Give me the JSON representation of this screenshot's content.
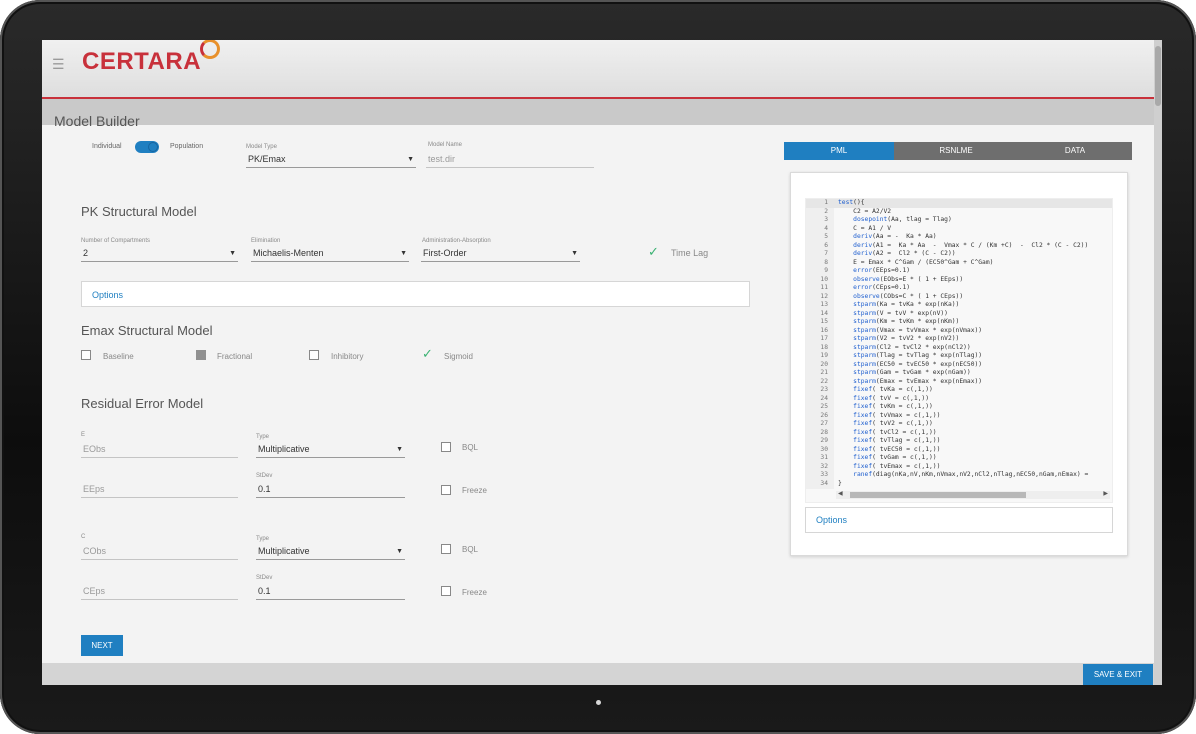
{
  "header": {
    "logo_text": "CERTARA",
    "menu_icon": "hamburger-icon"
  },
  "page": {
    "title": "Model Builder"
  },
  "mode_toggle": {
    "left_label": "Individual",
    "right_label": "Population"
  },
  "model_type": {
    "label": "Model Type",
    "value": "PK/Emax"
  },
  "model_name": {
    "label": "Model Name",
    "value": "test.dir"
  },
  "pk": {
    "title": "PK Structural Model",
    "compartments": {
      "label": "Number of Compartments",
      "value": "2"
    },
    "elimination": {
      "label": "Elimination",
      "value": "Michaelis-Menten"
    },
    "absorption": {
      "label": "Administration-Absorption",
      "value": "First-Order"
    },
    "time_lag": "Time Lag",
    "options": "Options"
  },
  "emax": {
    "title": "Emax Structural Model",
    "baseline": "Baseline",
    "fractional": "Fractional",
    "inhibitory": "Inhibitory",
    "sigmoid": "Sigmoid"
  },
  "residual": {
    "title": "Residual Error Model",
    "blocks": [
      {
        "var_label": "E",
        "obs": "EObs",
        "eps": "EEps",
        "type_label": "Type",
        "type": "Multiplicative",
        "stdev_label": "StDev",
        "stdev": "0.1",
        "bql": "BQL",
        "freeze": "Freeze"
      },
      {
        "var_label": "C",
        "obs": "CObs",
        "eps": "CEps",
        "type_label": "Type",
        "type": "Multiplicative",
        "stdev_label": "StDev",
        "stdev": "0.1",
        "bql": "BQL",
        "freeze": "Freeze"
      }
    ]
  },
  "buttons": {
    "next": "NEXT",
    "save_exit": "SAVE & EXIT"
  },
  "right_panel": {
    "tabs": [
      "PML",
      "RSNLME",
      "DATA"
    ],
    "options": "Options",
    "code": [
      "test(){",
      "    C2 = A2/V2",
      "    dosepoint(Aa, tlag = Tlag)",
      "    C = A1 / V",
      "    deriv(Aa = -  Ka * Aa)",
      "    deriv(A1 =  Ka * Aa  -  Vmax * C / (Km +C)  -  Cl2 * (C - C2))",
      "    deriv(A2 =  Cl2 * (C - C2))",
      "    E = Emax * C^Gam / (EC50^Gam + C^Gam)",
      "    error(EEps=0.1)",
      "    observe(EObs=E * ( 1 + EEps))",
      "    error(CEps=0.1)",
      "    observe(CObs=C * ( 1 + CEps))",
      "    stparm(Ka = tvKa * exp(nKa))",
      "    stparm(V = tvV * exp(nV))",
      "    stparm(Km = tvKm * exp(nKm))",
      "    stparm(Vmax = tvVmax * exp(nVmax))",
      "    stparm(V2 = tvV2 * exp(nV2))",
      "    stparm(Cl2 = tvCl2 * exp(nCl2))",
      "    stparm(Tlag = tvTlag * exp(nTlag))",
      "    stparm(EC50 = tvEC50 * exp(nEC50))",
      "    stparm(Gam = tvGam * exp(nGam))",
      "    stparm(Emax = tvEmax * exp(nEmax))",
      "    fixef( tvKa = c(,1,))",
      "    fixef( tvV = c(,1,))",
      "    fixef( tvKm = c(,1,))",
      "    fixef( tvVmax = c(,1,))",
      "    fixef( tvV2 = c(,1,))",
      "    fixef( tvCl2 = c(,1,))",
      "    fixef( tvTlag = c(,1,))",
      "    fixef( tvEC50 = c(,1,))",
      "    fixef( tvGam = c(,1,))",
      "    fixef( tvEmax = c(,1,))",
      "    ranef(diag(nKa,nV,nKm,nVmax,nV2,nCl2,nTlag,nEC50,nGam,nEmax) =",
      "}"
    ]
  },
  "colors": {
    "accent": "#1f7fc1",
    "brand": "#c8313b",
    "check": "#3bb273"
  }
}
